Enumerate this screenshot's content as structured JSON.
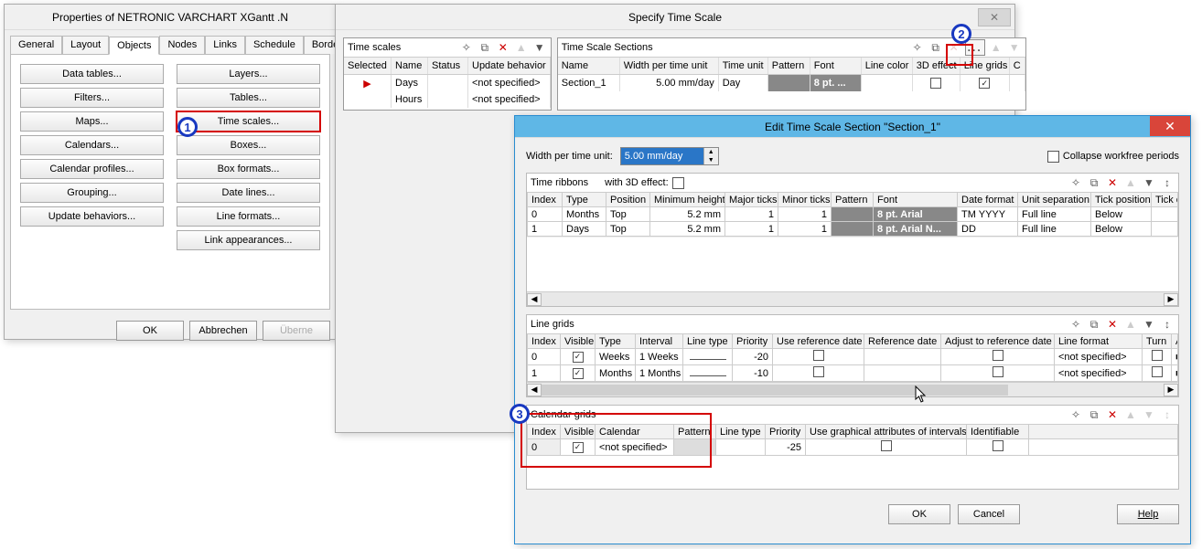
{
  "props": {
    "title": "Properties of NETRONIC VARCHART XGantt .N",
    "tabs": [
      "General",
      "Layout",
      "Objects",
      "Nodes",
      "Links",
      "Schedule",
      "Border Area"
    ],
    "activeTab": "Objects",
    "left": [
      "Data tables...",
      "Filters...",
      "Maps...",
      "Calendars...",
      "Calendar profiles...",
      "Grouping...",
      "Update behaviors..."
    ],
    "right": [
      "Layers...",
      "Tables...",
      "Time scales...",
      "Boxes...",
      "Box formats...",
      "Date lines...",
      "Line formats...",
      "Link appearances..."
    ],
    "ok": "OK",
    "cancel": "Abbrechen",
    "apply": "Überne"
  },
  "spec": {
    "title": "Specify Time Scale",
    "left": {
      "heading": "Time scales",
      "cols": [
        "Selected",
        "Name",
        "Status",
        "Update behavior"
      ],
      "rows": [
        {
          "selected": "▶",
          "name": "Days",
          "status": "",
          "upd": "<not specified>"
        },
        {
          "selected": "",
          "name": "Hours",
          "status": "",
          "upd": "<not specified>"
        }
      ]
    },
    "right": {
      "heading": "Time Scale Sections",
      "cols": [
        "Name",
        "Width per time unit",
        "Time unit",
        "Pattern",
        "Font",
        "Line color",
        "3D effect",
        "Line grids",
        "C"
      ],
      "row": {
        "name": "Section_1",
        "width": "5.00 mm/day",
        "unit": "Day",
        "pattern": "",
        "font": "8 pt. ...",
        "linecolor": "",
        "threeD": false,
        "grids": true
      }
    }
  },
  "edit": {
    "title": "Edit Time Scale Section \"Section_1\"",
    "widthLabel": "Width per time unit:",
    "widthValue": "5.00 mm/day",
    "collapse": "Collapse workfree periods",
    "ribbons": {
      "heading": "Time ribbons",
      "threeDLabel": "with 3D effect:",
      "cols": [
        "Index",
        "Type",
        "Position",
        "Minimum height",
        "Major ticks",
        "Minor ticks",
        "Pattern",
        "Font",
        "Date format",
        "Unit separation",
        "Tick position",
        "Tick color"
      ],
      "rows": [
        {
          "idx": "0",
          "type": "Months",
          "pos": "Top",
          "minh": "5.2 mm",
          "maj": "1",
          "min": "1",
          "pat": "",
          "font": "8 pt. Arial",
          "fmt": "TM YYYY",
          "sep": "Full line",
          "tpos": "Below",
          "tc": ""
        },
        {
          "idx": "1",
          "type": "Days",
          "pos": "Top",
          "minh": "5.2 mm",
          "maj": "1",
          "min": "1",
          "pat": "",
          "font": "8 pt. Arial N...",
          "fmt": "DD",
          "sep": "Full line",
          "tpos": "Below",
          "tc": ""
        }
      ]
    },
    "grids": {
      "heading": "Line grids",
      "cols": [
        "Index",
        "Visible",
        "Type",
        "Interval",
        "Line type",
        "Priority",
        "Use reference date",
        "Reference date",
        "Adjust to reference date",
        "Line format",
        "Turn",
        "Alignme"
      ],
      "rows": [
        {
          "idx": "0",
          "vis": true,
          "type": "Weeks",
          "interval": "1 Weeks",
          "ltype": "—",
          "prio": "-20",
          "useref": false,
          "refdate": "",
          "adj": false,
          "lfmt": "<not specified>",
          "turn": false,
          "al": "■"
        },
        {
          "idx": "1",
          "vis": true,
          "type": "Months",
          "interval": "1 Months",
          "ltype": "—",
          "prio": "-10",
          "useref": false,
          "refdate": "",
          "adj": false,
          "lfmt": "<not specified>",
          "turn": false,
          "al": "■"
        }
      ]
    },
    "calgrids": {
      "heading": "Calendar grids",
      "cols": [
        "Index",
        "Visible",
        "Calendar",
        "Pattern",
        "Line type",
        "Priority",
        "Use graphical attributes of intervals",
        "Identifiable"
      ],
      "rows": [
        {
          "idx": "0",
          "vis": true,
          "cal": "<not specified>",
          "pat": "",
          "ltype": "",
          "prio": "-25",
          "useg": false,
          "ident": false
        }
      ]
    },
    "ok": "OK",
    "cancel": "Cancel",
    "help": "Help"
  }
}
